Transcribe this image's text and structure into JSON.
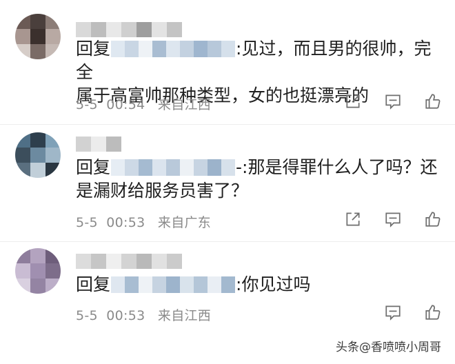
{
  "comments": [
    {
      "reply_prefix": "回复",
      "text_line1": ":见过，而且男的很帅，完全",
      "text_line2": "属于高富帅那种类型，女的也挺漂亮的",
      "date": "5-5",
      "time": "00:54",
      "location": "来自江西"
    },
    {
      "reply_prefix": "回复",
      "text_line1": "-:那是得罪什么人了吗？还",
      "text_line2": "是漏财给服务员害了？",
      "date": "5-5",
      "time": "00:53",
      "location": "来自广东"
    },
    {
      "reply_prefix": "回复",
      "text_line1": ":你见过吗",
      "text_line2": "",
      "date": "5-5",
      "time": "00:53",
      "location": "来自江西"
    }
  ],
  "actions": [
    "share-icon",
    "comment-icon",
    "like-icon"
  ],
  "watermark": "头条@香喷喷小周哥",
  "colors": {
    "text": "#1f1f1f",
    "meta": "#8a8a8a",
    "blur_a": "#9fb6cf",
    "blur_b": "#c9d6e4"
  }
}
